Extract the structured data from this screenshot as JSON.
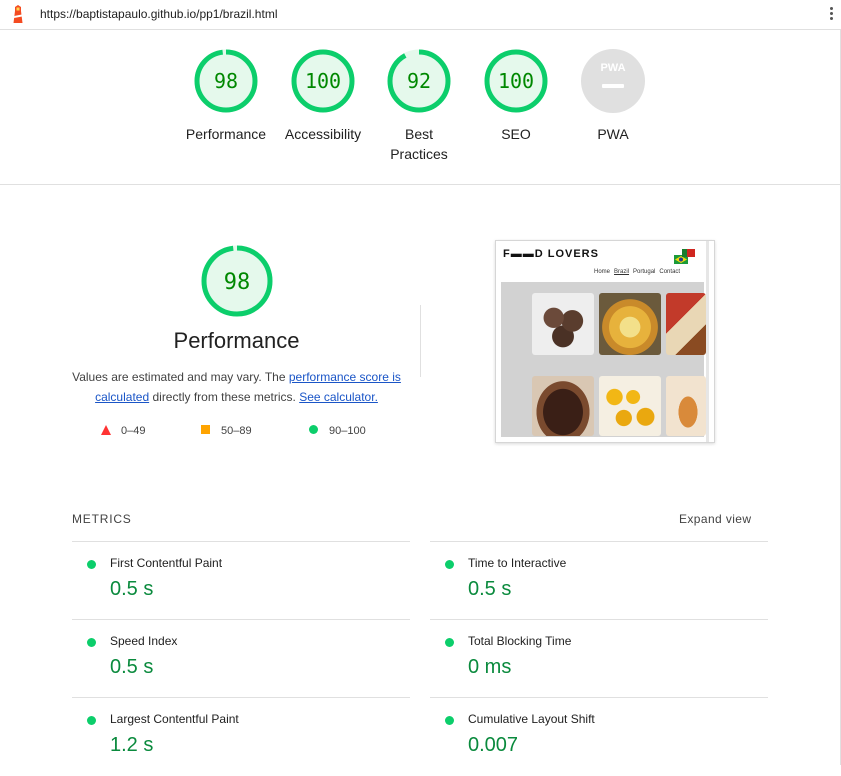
{
  "browser": {
    "url": "https://baptistapaulo.github.io/pp1/brazil.html",
    "lighthouse_icon": "lighthouse-icon",
    "menu_icon": "kebab-menu-icon"
  },
  "colors": {
    "pass": "#0cce6b",
    "pass_text": "#008800",
    "pass_fill": "#e5f9ec",
    "average": "#ffa400",
    "fail": "#ff3333",
    "link": "#1a55c7",
    "na": "#e0e0e0"
  },
  "gauges": [
    {
      "score": "98",
      "label": "Performance",
      "fraction": 0.98
    },
    {
      "score": "100",
      "label": "Accessibility",
      "fraction": 1.0
    },
    {
      "score": "92",
      "label": "Best Practices",
      "label_line1": "Best",
      "label_line2": "Practices",
      "fraction": 0.92
    },
    {
      "score": "100",
      "label": "SEO",
      "fraction": 1.0
    },
    {
      "score": "PWA",
      "label": "PWA",
      "fraction": 0
    }
  ],
  "performance": {
    "score": "98",
    "fraction": 0.98,
    "title": "Performance",
    "desc_part1": "Values are estimated and may vary. The ",
    "link1": "performance score is calculated",
    "desc_part2": " directly from these metrics. ",
    "link2": "See calculator."
  },
  "legend": [
    {
      "range": "0–49",
      "shape": "triangle"
    },
    {
      "range": "50–89",
      "shape": "square"
    },
    {
      "range": "90–100",
      "shape": "circle"
    }
  ],
  "screenshot": {
    "brand": "F▬▬D LOVERS",
    "nav": [
      "Home",
      "Brazil",
      "Portugal",
      "Contact"
    ]
  },
  "metrics": {
    "heading": "METRICS",
    "expand": "Expand view",
    "items": [
      {
        "name": "First Contentful Paint",
        "value": "0.5 s"
      },
      {
        "name": "Time to Interactive",
        "value": "0.5 s"
      },
      {
        "name": "Speed Index",
        "value": "0.5 s"
      },
      {
        "name": "Total Blocking Time",
        "value": "0 ms"
      },
      {
        "name": "Largest Contentful Paint",
        "value": "1.2 s"
      },
      {
        "name": "Cumulative Layout Shift",
        "value": "0.007"
      }
    ]
  }
}
